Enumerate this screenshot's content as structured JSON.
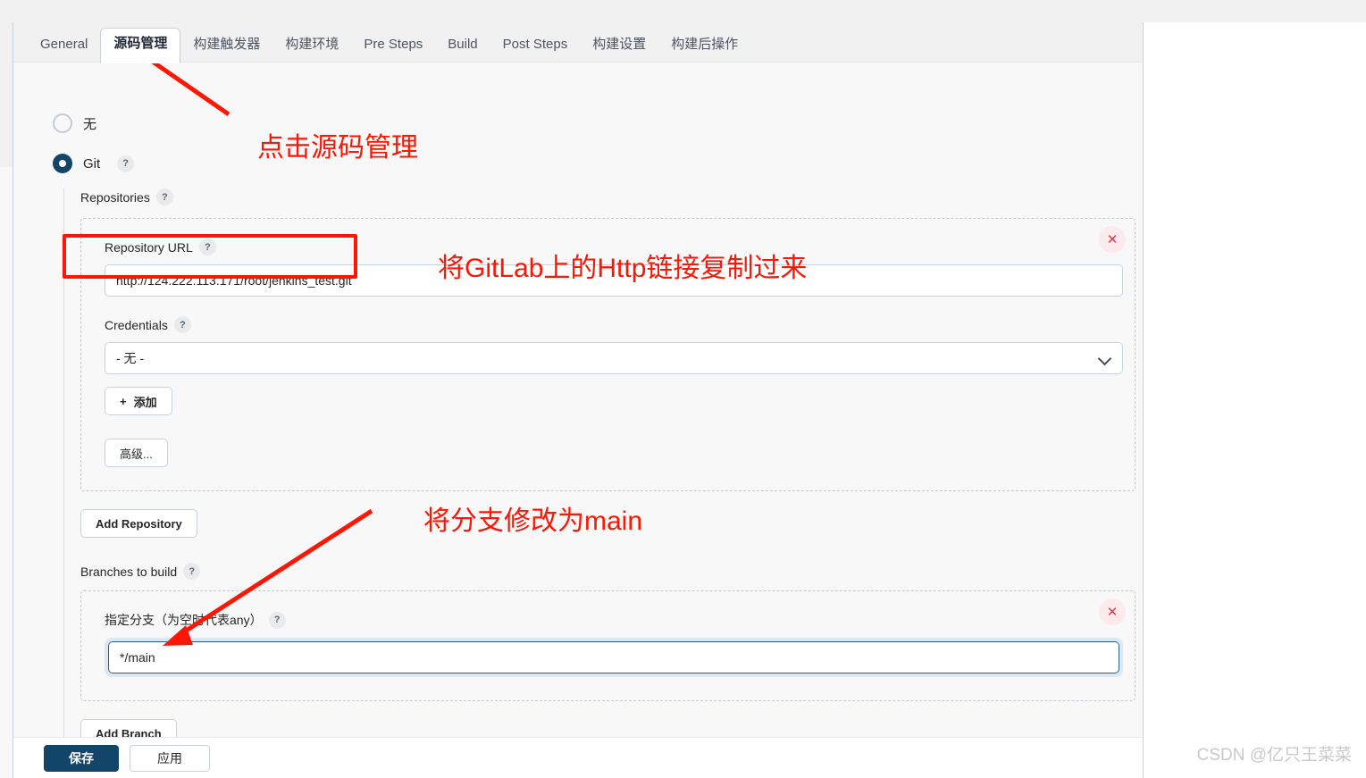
{
  "tabs": [
    {
      "label": "General",
      "active": false
    },
    {
      "label": "源码管理",
      "active": true
    },
    {
      "label": "构建触发器",
      "active": false
    },
    {
      "label": "构建环境",
      "active": false
    },
    {
      "label": "Pre Steps",
      "active": false
    },
    {
      "label": "Build",
      "active": false
    },
    {
      "label": "Post Steps",
      "active": false
    },
    {
      "label": "构建设置",
      "active": false
    },
    {
      "label": "构建后操作",
      "active": false
    }
  ],
  "scm": {
    "radio_none_label": "无",
    "radio_git_label": "Git",
    "radio_git_selected": true,
    "help_glyph": "?",
    "repositories_label": "Repositories",
    "repository_url_label": "Repository URL",
    "repository_url_value": "http://124.222.113.171/root/jenkins_test.git",
    "credentials_label": "Credentials",
    "credentials_value": "- 无 -",
    "add_credentials_label": "添加",
    "add_credentials_plus": "+",
    "advanced_label": "高级...",
    "add_repository_label": "Add Repository",
    "branches_to_build_label": "Branches to build",
    "branch_specifier_label": "指定分支（为空时代表any）",
    "branch_specifier_value": "*/main",
    "add_branch_label": "Add Branch",
    "delete_icon_glyph": "✕"
  },
  "actions": {
    "save_label": "保存",
    "apply_label": "应用"
  },
  "annotations": [
    {
      "text": "点击源码管理"
    },
    {
      "text": "将GitLab上的Http链接复制过来"
    },
    {
      "text": "将分支修改为main"
    }
  ],
  "watermark": "CSDN @亿只王菜菜",
  "colors": {
    "accent": "#124568",
    "annotation": "#fb1605",
    "panel_bg": "#f8f8f8",
    "danger": "#e0394a"
  }
}
